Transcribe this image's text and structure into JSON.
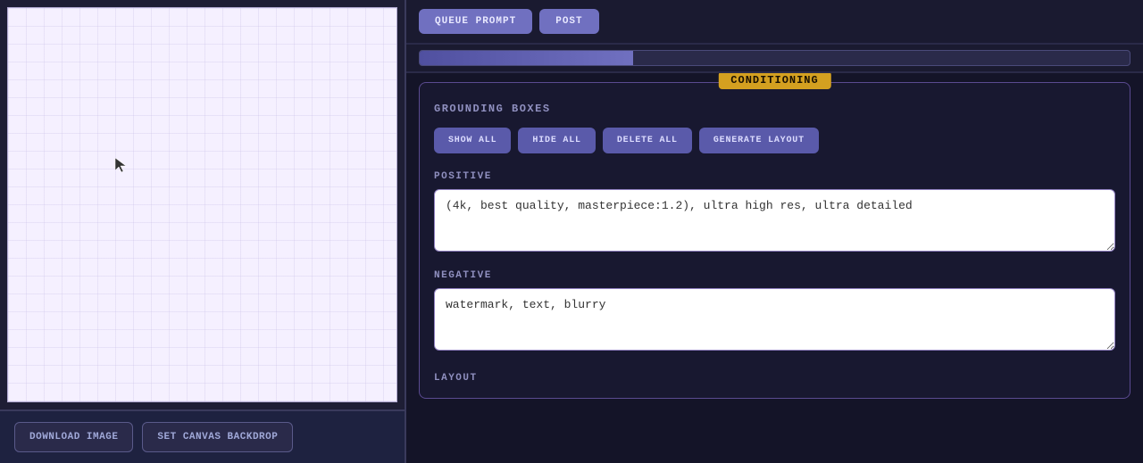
{
  "leftPanel": {
    "downloadButton": "DOWNLOAD IMAGE",
    "backdropButton": "SET CaNVas BAcKDROP"
  },
  "topBar": {
    "queueButton": "QUEUE PROMPT",
    "postButton": "POST"
  },
  "conditioning": {
    "sectionLabel": "CONDITIONING",
    "groundingTitle": "GROUNDING BOXES",
    "showAllButton": "SHOW ALL",
    "hideAllButton": "HIDE ALL",
    "deleteAllButton": "DELETE ALL",
    "generateLayoutButton": "GENERATE LAYOUT",
    "positiveLabel": "POSITIVE",
    "positiveValue": "(4k, best quality, masterpiece:1.2), ultra high res, ultra detailed",
    "negativeLabel": "NEGATIVE",
    "negativeValue": "watermark, text, blurry",
    "layoutLabel": "LAYOUT"
  },
  "colors": {
    "accent": "#d4a020",
    "button": "#7070c0",
    "grounding": "#5a5aaa"
  }
}
